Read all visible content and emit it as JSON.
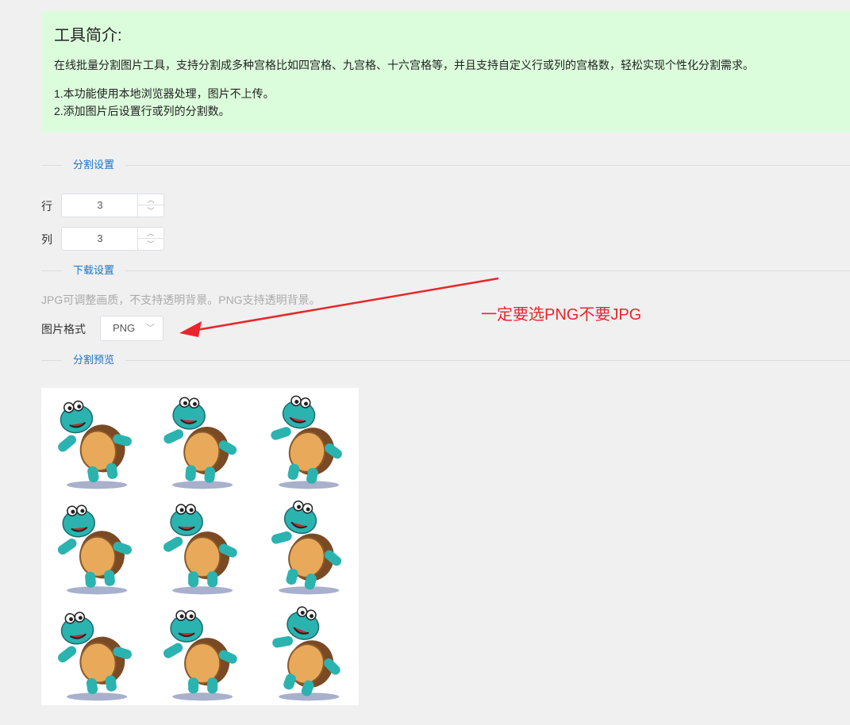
{
  "intro": {
    "title": "工具简介:",
    "description": "在线批量分割图片工具，支持分割成多种宫格比如四宫格、九宫格、十六宫格等，并且支持自定义行或列的宫格数，轻松实现个性化分割需求。",
    "note1": "1.本功能使用本地浏览器处理，图片不上传。",
    "note2": "2.添加图片后设置行或列的分割数。"
  },
  "split_settings": {
    "heading": "分割设置",
    "rows_label": "行",
    "rows_value": "3",
    "cols_label": "列",
    "cols_value": "3"
  },
  "download_settings": {
    "heading": "下载设置",
    "hint": "JPG可调整画质，不支持透明背景。PNG支持透明背景。",
    "format_label": "图片格式",
    "format_value": "PNG"
  },
  "annotation": {
    "text": "一定要选PNG不要JPG",
    "color": "#e8262b"
  },
  "preview": {
    "heading": "分割预览",
    "grid": {
      "rows": 3,
      "cols": 3
    }
  },
  "colors": {
    "accent": "#1a73c8",
    "intro_bg": "#dcfddc",
    "turtle_skin": "#2bb3b0",
    "turtle_shell": "#e8a95a"
  }
}
